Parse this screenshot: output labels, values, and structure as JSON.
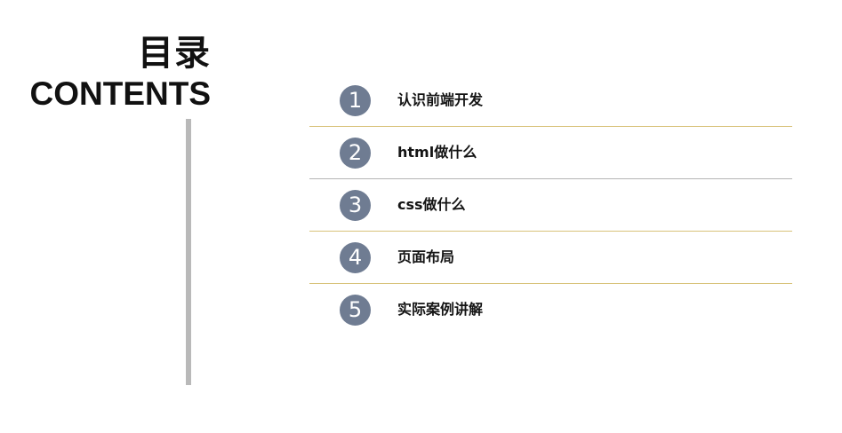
{
  "heading": {
    "title_cn": "目录",
    "title_en": "CONTENTS"
  },
  "toc": {
    "items": [
      {
        "number": "1",
        "label": "认识前端开发"
      },
      {
        "number": "2",
        "label": "html做什么"
      },
      {
        "number": "3",
        "label": "css做什么"
      },
      {
        "number": "4",
        "label": "页面布局"
      },
      {
        "number": "5",
        "label": "实际案例讲解"
      }
    ]
  },
  "colors": {
    "badge": "#6f7c92",
    "separator_gold": "#d8c27a",
    "separator_gray": "#b5b5b5",
    "vertical_rule": "#b9b9b9"
  }
}
